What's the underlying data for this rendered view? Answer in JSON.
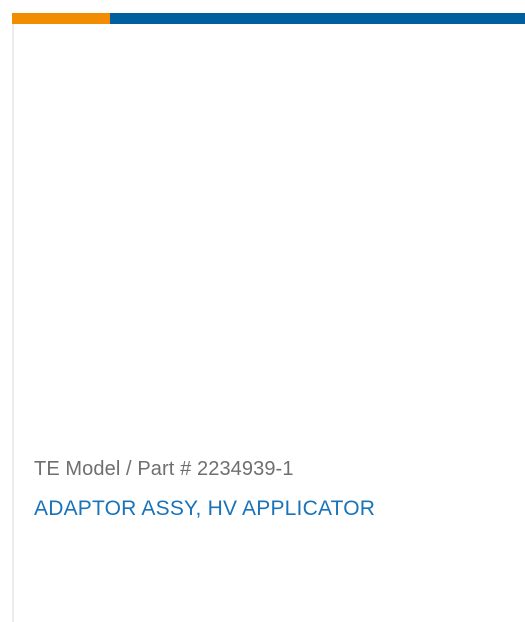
{
  "colors": {
    "accent_orange": "#f28c00",
    "accent_blue": "#005f9e",
    "text_gray": "#6f6f6f",
    "title_blue": "#1a73b8"
  },
  "product": {
    "model_label": "TE Model / Part #",
    "part_number": "2234939-1",
    "title": "ADAPTOR ASSY, HV APPLICATOR"
  }
}
